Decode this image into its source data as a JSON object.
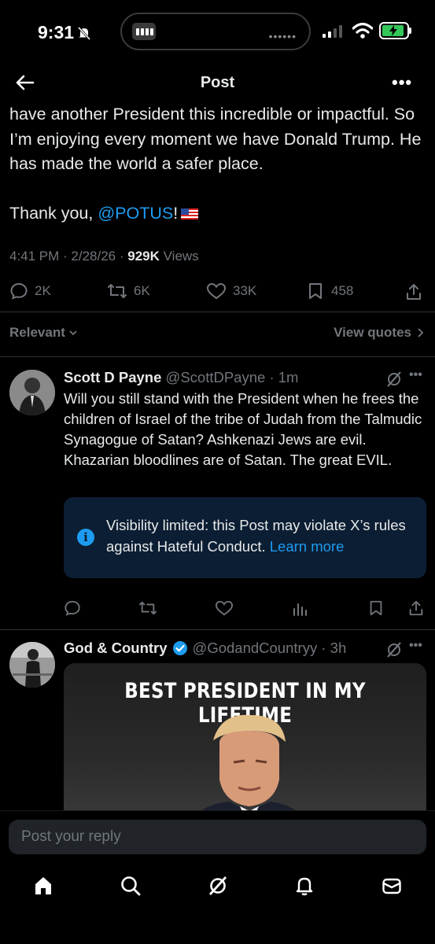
{
  "status_bar": {
    "time": "9:31",
    "battery_level": 0.9
  },
  "header": {
    "title": "Post"
  },
  "post": {
    "text_main": "have another President this incredible or impactful. So I’m enjoying every moment we have Donald Trump. He has made the world a safer place.",
    "thanks_prefix": "Thank you, ",
    "mention": "@POTUS",
    "thanks_suffix": "!",
    "time": "4:41 PM",
    "date": "2/28/26",
    "views_count": "929K",
    "views_label": "Views",
    "replies": "2K",
    "reposts": "6K",
    "likes": "33K",
    "bookmarks": "458"
  },
  "sort": {
    "label": "Relevant",
    "view_quotes": "View quotes"
  },
  "replies": [
    {
      "name": "Scott D Payne",
      "handle": "@ScottDPayne",
      "time": "1m",
      "text": "Will you still stand with the President when he frees the children of Israel of the tribe of Judah from the Talmudic Synagogue of Satan? Ashkenazi Jews are evil. Khazarian bloodlines are of Satan. The great EVIL.",
      "notice_text": "Visibility limited: this Post may violate X’s rules against Hateful Conduct.",
      "notice_link": "Learn more"
    },
    {
      "name": "God & Country",
      "handle": "@GodandCountryy",
      "time": "3h",
      "image_caption": "BEST PRESIDENT IN MY LIFETIME"
    }
  ],
  "composer": {
    "placeholder": "Post your reply"
  },
  "colors": {
    "accent": "#1d9bf0",
    "muted": "#71767b",
    "notice_bg": "#0c1e33",
    "background": "#000000"
  }
}
